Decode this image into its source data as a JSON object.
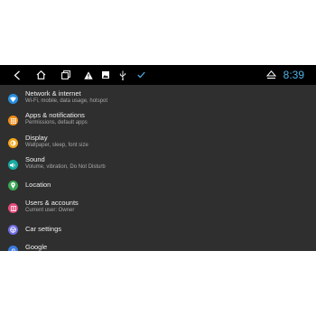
{
  "status_bar": {
    "clock": "8:39",
    "accent": "#4fb3e8",
    "icons": [
      "back-icon",
      "home-icon",
      "recents-icon",
      "warning-icon",
      "image-icon",
      "usb-icon",
      "check-icon",
      "eject-icon"
    ]
  },
  "settings": [
    {
      "title": "Network & internet",
      "subtitle": "Wi-Fi, mobile, data usage, hotspot",
      "icon": "wifi-icon",
      "color": "#2a8fe0"
    },
    {
      "title": "Apps & notifications",
      "subtitle": "Permissions, default apps",
      "icon": "apps-icon",
      "color": "#f08f1b"
    },
    {
      "title": "Display",
      "subtitle": "Wallpaper, sleep, font size",
      "icon": "brightness-icon",
      "color": "#f3a61c"
    },
    {
      "title": "Sound",
      "subtitle": "Volume, vibration, Do Not Disturb",
      "icon": "volume-icon",
      "color": "#18a9a2"
    },
    {
      "title": "Location",
      "subtitle": "",
      "icon": "location-icon",
      "color": "#3aa655"
    },
    {
      "title": "Users & accounts",
      "subtitle": "Current user: Owner",
      "icon": "user-icon",
      "color": "#e74a7a"
    },
    {
      "title": "Car settings",
      "subtitle": "",
      "icon": "steering-wheel-icon",
      "color": "#6f6ce4"
    },
    {
      "title": "Google",
      "subtitle": "",
      "icon": "google-icon",
      "color": "#3b7be0"
    }
  ]
}
